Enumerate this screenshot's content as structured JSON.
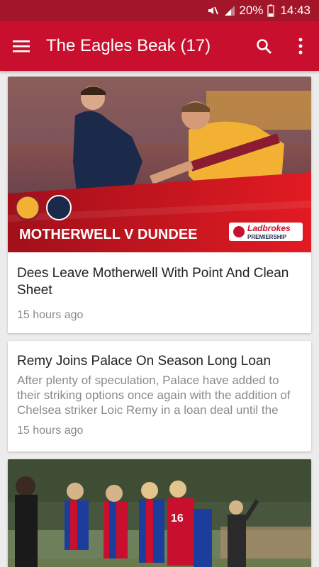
{
  "status_bar": {
    "battery": "20%",
    "time": "14:43",
    "icons": [
      "mute-icon",
      "signal-icon",
      "battery-icon"
    ]
  },
  "app_bar": {
    "title": "The Eagles Beak (17)",
    "icons": [
      "menu-icon",
      "search-icon",
      "more-vert-icon"
    ]
  },
  "articles": [
    {
      "image_caption": "MOTHERWELL V DUNDEE",
      "sponsor_name": "Ladbrokes",
      "sponsor_sub": "PREMIERSHIP",
      "title": "Dees Leave Motherwell With Point And Clean Sheet",
      "time": "15 hours ago"
    },
    {
      "title": "Remy Joins Palace On Season Long Loan",
      "excerpt": "After plenty of speculation, Palace have added to their striking options once again with the addition of Chelsea striker Loic Remy in a loan deal until the",
      "time": "15 hours ago"
    },
    {
      "image_alt": "Players celebrating"
    }
  ],
  "colors": {
    "status_bar": "#a3162a",
    "app_bar": "#c8102e",
    "background": "#ececec"
  }
}
